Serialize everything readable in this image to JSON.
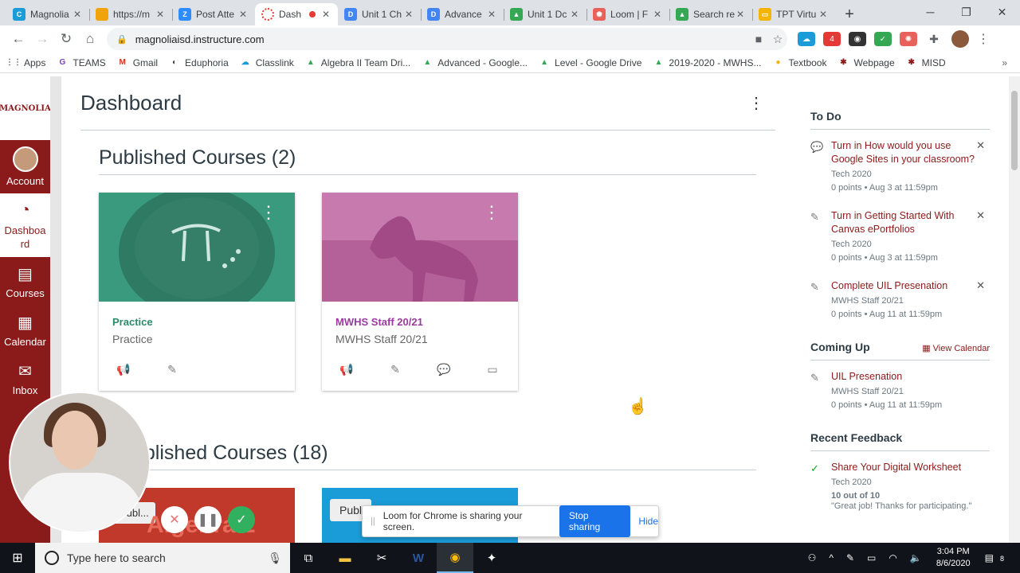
{
  "browser": {
    "tabs": [
      {
        "title": "Magnolia",
        "favicon_color": "#1a9cd8",
        "favicon": "C"
      },
      {
        "title": "https://m",
        "favicon_color": "#f0a30a",
        "favicon": ""
      },
      {
        "title": "Post Atte",
        "favicon_color": "#2d8cff",
        "favicon": "Z"
      },
      {
        "title": "Dash",
        "favicon_color": "#e53935",
        "favicon": "",
        "active": true
      },
      {
        "title": "Unit 1 Ch",
        "favicon_color": "#4285f4",
        "favicon": "D"
      },
      {
        "title": "Advance",
        "favicon_color": "#4285f4",
        "favicon": "D"
      },
      {
        "title": "Unit 1 Dc",
        "favicon_color": "#34a853",
        "favicon": "▲"
      },
      {
        "title": "Loom | F",
        "favicon_color": "#e8615a",
        "favicon": "✺"
      },
      {
        "title": "Search re",
        "favicon_color": "#34a853",
        "favicon": "▲"
      },
      {
        "title": "TPT Virtu",
        "favicon_color": "#f5b400",
        "favicon": "▭"
      }
    ],
    "new_tab_label": "+",
    "url": "magnoliaisd.instructure.com",
    "bookmarks": [
      {
        "label": "Apps",
        "icon": "⋮⋮",
        "color": "#5f6368"
      },
      {
        "label": "TEAMS",
        "icon": "G",
        "color": "#7b3fbf"
      },
      {
        "label": "Gmail",
        "icon": "M",
        "color": "#d93025"
      },
      {
        "label": "Eduphoria",
        "icon": "◐",
        "color": "#444"
      },
      {
        "label": "Classlink",
        "icon": "☁",
        "color": "#1a9cd8"
      },
      {
        "label": "Algebra II Team Dri...",
        "icon": "▲",
        "color": "#34a853"
      },
      {
        "label": "Advanced - Google...",
        "icon": "▲",
        "color": "#34a853"
      },
      {
        "label": "Level - Google Drive",
        "icon": "▲",
        "color": "#34a853"
      },
      {
        "label": "2019-2020 - MWHS...",
        "icon": "▲",
        "color": "#34a853"
      },
      {
        "label": "Textbook",
        "icon": "●",
        "color": "#f5b400"
      },
      {
        "label": "Webpage",
        "icon": "✱",
        "color": "#8b1a1a"
      },
      {
        "label": "MISD",
        "icon": "✱",
        "color": "#8b1a1a"
      }
    ],
    "bookmarks_more": "»"
  },
  "global_nav": {
    "logo_text": "MAGNOLIA",
    "items": [
      {
        "label": "Account",
        "icon": "avatar"
      },
      {
        "label": "Dashboard",
        "icon": "speedometer-icon",
        "display": "Dashboa rd",
        "active": true
      },
      {
        "label": "Courses",
        "icon": "book-icon"
      },
      {
        "label": "Calendar",
        "icon": "calendar-icon"
      },
      {
        "label": "Inbox",
        "icon": "inbox-icon"
      }
    ]
  },
  "dashboard": {
    "title": "Dashboard",
    "published_heading": "Published Courses (2)",
    "unpublished_heading": "ublished Courses (18)",
    "published_cards": [
      {
        "code": "Practice",
        "name": "Practice",
        "accent": "#2b8a6b",
        "hero": "#3a9a7e"
      },
      {
        "code": "MWHS Staff 20/21",
        "name": "MWHS Staff 20/21",
        "accent": "#9b3aa0",
        "hero": "#b04a8a"
      }
    ],
    "unpublished_cards": [
      {
        "label": "Publ...",
        "hero": "#c0392b"
      },
      {
        "label": "Publ",
        "hero": "#1a9cd8"
      }
    ]
  },
  "sidebar": {
    "todo_heading": "To Do",
    "todo": [
      {
        "title": "Turn in How would you use Google Sites in your classroom?",
        "course": "Tech 2020",
        "meta": "0 points • Aug 3 at 11:59pm"
      },
      {
        "title": "Turn in Getting Started With Canvas ePortfolios",
        "course": "Tech 2020",
        "meta": "0 points • Aug 3 at 11:59pm"
      },
      {
        "title": "Complete UIL Presenation",
        "course": "MWHS Staff 20/21",
        "meta": "0 points • Aug 11 at 11:59pm"
      }
    ],
    "coming_up_heading": "Coming Up",
    "view_calendar": "View Calendar",
    "coming_up": [
      {
        "title": "UIL Presenation",
        "course": "MWHS Staff 20/21",
        "meta": "0 points • Aug 11 at 11:59pm"
      }
    ],
    "feedback_heading": "Recent Feedback",
    "feedback": [
      {
        "title": "Share Your Digital Worksheet",
        "course": "Tech 2020",
        "score": "10 out of 10",
        "comment": "\"Great job! Thanks for participating.\""
      }
    ]
  },
  "loom": {
    "sharing_text": "Loom for Chrome is sharing your screen.",
    "stop_label": "Stop sharing",
    "hide_label": "Hide"
  },
  "taskbar": {
    "search_placeholder": "Type here to search",
    "time": "3:04 PM",
    "date": "8/6/2020",
    "notifications": "8"
  }
}
